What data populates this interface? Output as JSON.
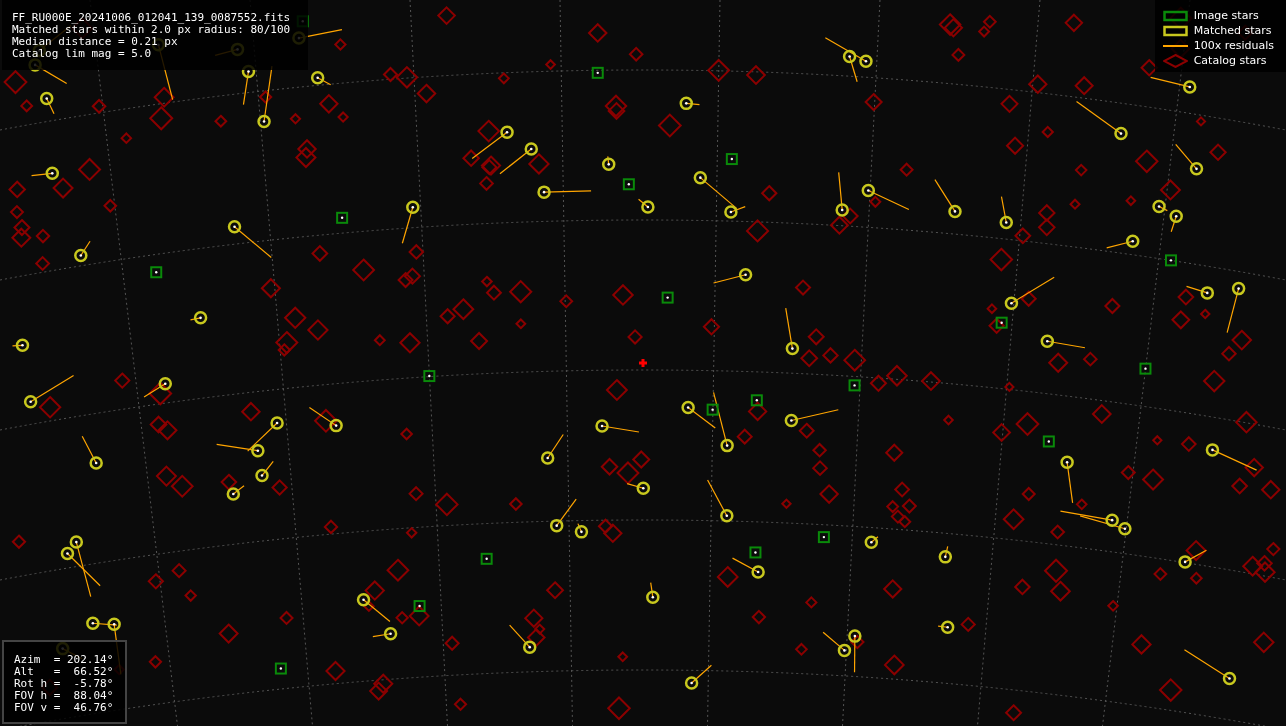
{
  "info_box": {
    "lines": [
      "FF_RU000E_20241006_012041_139_0087552.fits",
      "Matched stars within 2.0 px radius: 80/100",
      "Median distance = 0.21 px",
      "Catalog lim mag = 5.0"
    ]
  },
  "legend": {
    "items": [
      {
        "kind": "image",
        "label": "Image stars",
        "color": "#0a8a0a"
      },
      {
        "kind": "matched",
        "label": "Matched stars",
        "color": "#c8c81e"
      },
      {
        "kind": "residual",
        "label": "100x residuals",
        "color": "#ffa500"
      },
      {
        "kind": "catalog",
        "label": "Catalog stars",
        "color": "#8b0000"
      }
    ]
  },
  "pointing_box": {
    "lines": [
      "Azim  = 202.14°",
      "Alt   =  66.52°",
      "Rot h =  -5.78°",
      "FOV h =  88.04°",
      "FOV v =  46.76°"
    ]
  }
}
